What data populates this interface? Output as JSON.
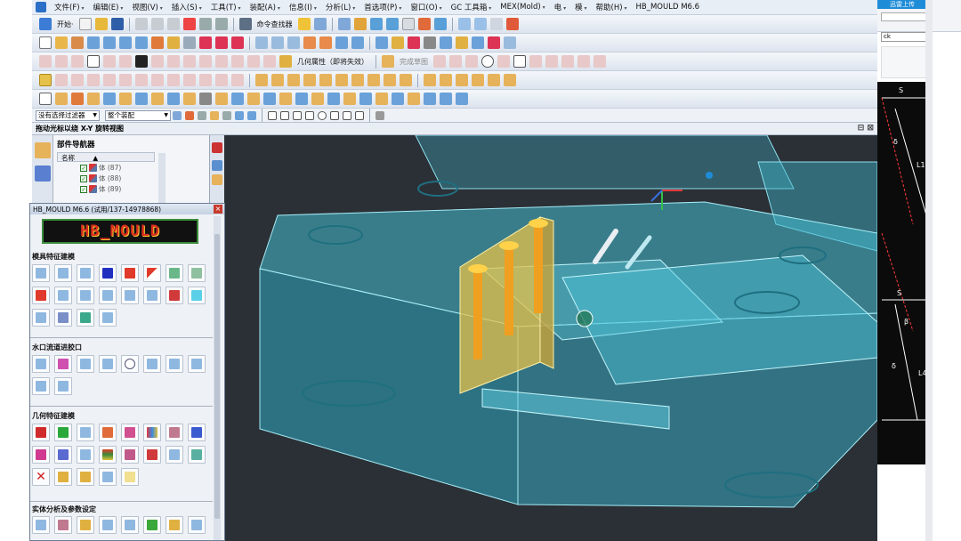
{
  "menubar": {
    "items": [
      "文件(F)",
      "编辑(E)",
      "视图(V)",
      "插入(S)",
      "工具(T)",
      "装配(A)",
      "信息(I)",
      "分析(L)",
      "首选项(P)",
      "窗口(O)",
      "GC 工具箱",
      "MEX(Mold)",
      "电",
      "模",
      "帮助(H)",
      "HB_MOULD M6.6"
    ]
  },
  "toolbar": {
    "start_label": "开始·",
    "command_finder_label": "命令查找器",
    "geom_props_label": "几何属性（即将失效）",
    "finish_sketch_label": "完成草图"
  },
  "selection_bar": {
    "filter_value": "没有选择过滤器",
    "scope_value": "整个装配"
  },
  "cue_line": {
    "text": "拖动光标以绕 X-Y 旋转视图"
  },
  "part_navigator": {
    "title": "部件导航器",
    "header_name": "名称",
    "rows": [
      "体 (87)",
      "体 (88)",
      "体 (89)"
    ]
  },
  "hb_mould_panel": {
    "title": "HB_MOULD M6.6 (试用/137-14978868)",
    "logo_text": "HB_MOULD",
    "sections": [
      "模具特征建模",
      "水口流道进胶口",
      "几何特征建模",
      "实体分析及参数设定"
    ]
  },
  "right_panel": {
    "badge_text": "迅雷上传",
    "input_value": "ck",
    "dim_labels": [
      "S",
      "δ",
      "L1",
      "S",
      "β",
      "δ",
      "L4"
    ]
  },
  "colors": {
    "viewport_bg": "#2b3036",
    "mould_body": "#3fb3c9",
    "ejector_plate": "#e6c24a",
    "window_bg": "#dfe6ef"
  }
}
